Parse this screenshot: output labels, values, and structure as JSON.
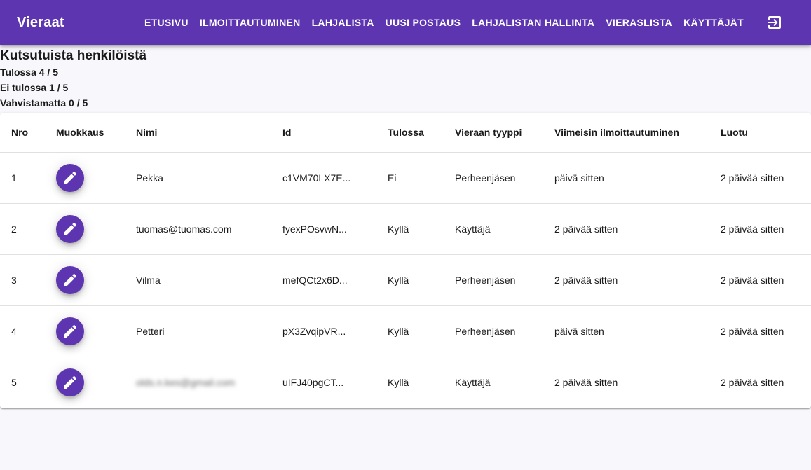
{
  "app": {
    "title": "Vieraat"
  },
  "nav": {
    "items": [
      "ETUSIVU",
      "ILMOITTAUTUMINEN",
      "LAHJALISTA",
      "UUSI POSTAUS",
      "LAHJALISTAN HALLINTA",
      "VIERASLISTA",
      "KÄYTTÄJÄT"
    ]
  },
  "summary": {
    "title": "Kutsutuista henkilöistä",
    "attending": "Tulossa 4 / 5",
    "not_attending": "Ei tulossa 1 / 5",
    "unconfirmed": "Vahvistamatta 0 / 5"
  },
  "table": {
    "headers": [
      "Nro",
      "Muokkaus",
      "Nimi",
      "Id",
      "Tulossa",
      "Vieraan tyyppi",
      "Viimeisin ilmoittautuminen",
      "Luotu"
    ],
    "rows": [
      {
        "nro": "1",
        "name": "Pekka",
        "id": "c1VM70LX7E...",
        "attending": "Ei",
        "type": "Perheenjäsen",
        "last": "päivä sitten",
        "created": "2 päivää sitten"
      },
      {
        "nro": "2",
        "name": "tuomas@tuomas.com",
        "id": "fyexPOsvwN...",
        "attending": "Kyllä",
        "type": "Käyttäjä",
        "last": "2 päivää sitten",
        "created": "2 päivää sitten"
      },
      {
        "nro": "3",
        "name": "Vilma",
        "id": "mefQCt2x6D...",
        "attending": "Kyllä",
        "type": "Perheenjäsen",
        "last": "2 päivää sitten",
        "created": "2 päivää sitten"
      },
      {
        "nro": "4",
        "name": "Petteri",
        "id": "pX3ZvqipVR...",
        "attending": "Kyllä",
        "type": "Perheenjäsen",
        "last": "päivä sitten",
        "created": "2 päivää sitten"
      },
      {
        "nro": "5",
        "name": "olds.n.kes@gmail.com",
        "id": "uIFJ40pgCT...",
        "attending": "Kyllä",
        "type": "Käyttäjä",
        "last": "2 päivää sitten",
        "created": "2 päivää sitten"
      }
    ]
  },
  "icons": {
    "edit": "pencil-icon",
    "logout": "logout-icon"
  },
  "colors": {
    "primary": "#5e35b1",
    "background": "#f8f7fb"
  }
}
